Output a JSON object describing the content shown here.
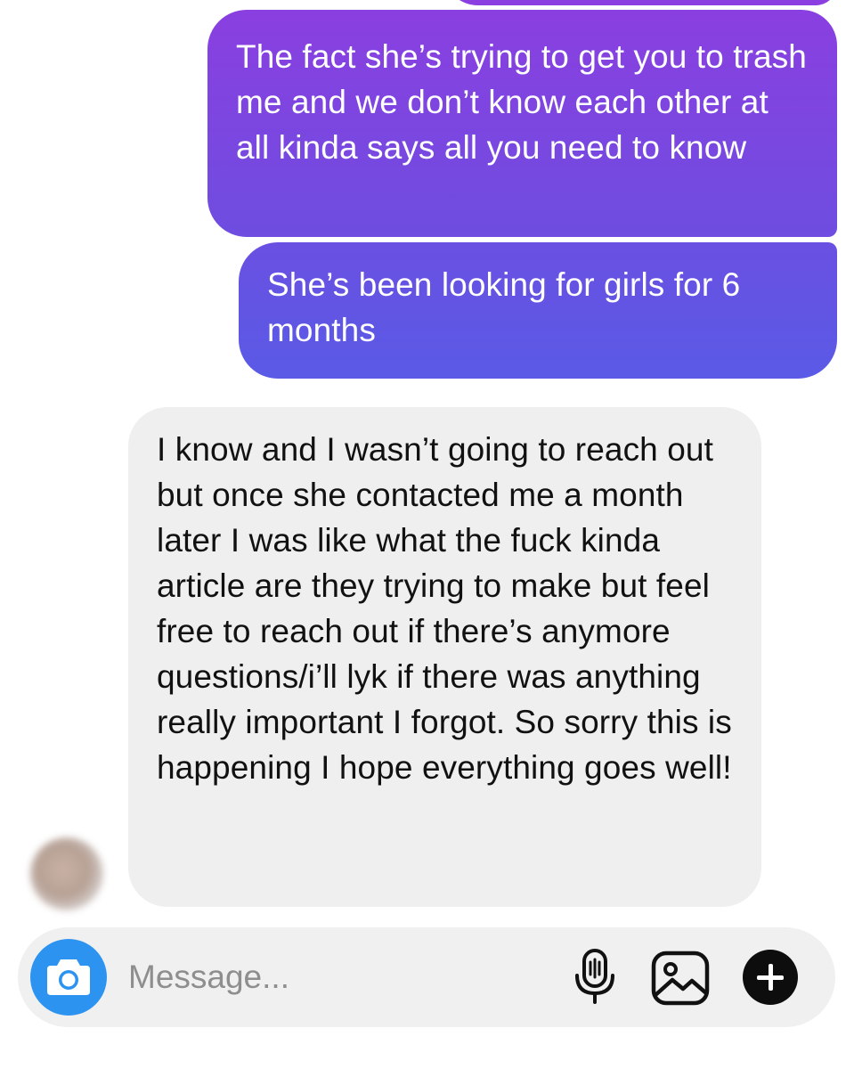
{
  "conversation": {
    "messages": [
      {
        "sender": "me",
        "text": "The fact she’s trying to get you to trash me and we don’t know each other at all kinda says all you need to know"
      },
      {
        "sender": "me",
        "text": "She’s been looking for girls for 6 months"
      },
      {
        "sender": "contact",
        "text": "I know and I wasn’t going to reach out but once she contacted me a month later I was like what the fuck kinda article are they trying to make but feel free to reach out if there’s anymore questions/i’ll lyk if there was anything really important I forgot. So sorry this is happening I hope everything goes well!"
      }
    ]
  },
  "composer": {
    "placeholder": "Message...",
    "icons": {
      "camera": "camera-icon",
      "mic": "microphone-icon",
      "gallery": "image-gallery-icon",
      "add": "plus-icon"
    }
  },
  "colors": {
    "outgoing_top": "#8a3fe0",
    "outgoing_bottom": "#5a5ae6",
    "incoming": "#efefef",
    "camera_button": "#2d93f1"
  }
}
